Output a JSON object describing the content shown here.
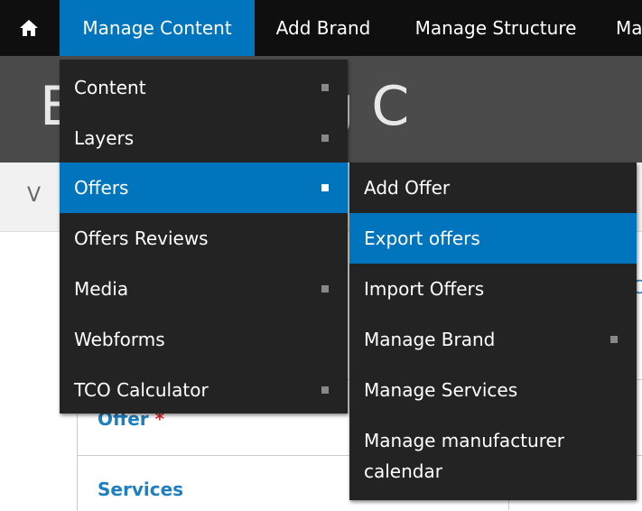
{
  "toolbar": {
    "home_icon": "home-icon",
    "items": [
      {
        "label": "Manage Content"
      },
      {
        "label": "Add Brand"
      },
      {
        "label": "Manage Structure"
      },
      {
        "label": "Ma"
      }
    ],
    "active_color": "#0074bd"
  },
  "page": {
    "title": "E     y Training C",
    "tab_text": "V",
    "form": {
      "offer_label": "Offer",
      "required_mark": "*",
      "services_label": "Services"
    },
    "edge_glyph": "C"
  },
  "menu": {
    "items": [
      {
        "label": "Content",
        "has_submenu": true
      },
      {
        "label": "Layers",
        "has_submenu": true
      },
      {
        "label": "Offers",
        "has_submenu": true,
        "active": true
      },
      {
        "label": "Offers Reviews",
        "has_submenu": false
      },
      {
        "label": "Media",
        "has_submenu": true
      },
      {
        "label": "Webforms",
        "has_submenu": false
      },
      {
        "label": "TCO Calculator",
        "has_submenu": true
      }
    ]
  },
  "submenu": {
    "items": [
      {
        "label": "Add Offer",
        "has_submenu": false
      },
      {
        "label": "Export offers",
        "has_submenu": false,
        "active": true
      },
      {
        "label": "Import Offers",
        "has_submenu": false
      },
      {
        "label": "Manage Brand",
        "has_submenu": true
      },
      {
        "label": "Manage Services",
        "has_submenu": false
      },
      {
        "label": "Manage manufacturer calendar",
        "has_submenu": false
      }
    ]
  }
}
